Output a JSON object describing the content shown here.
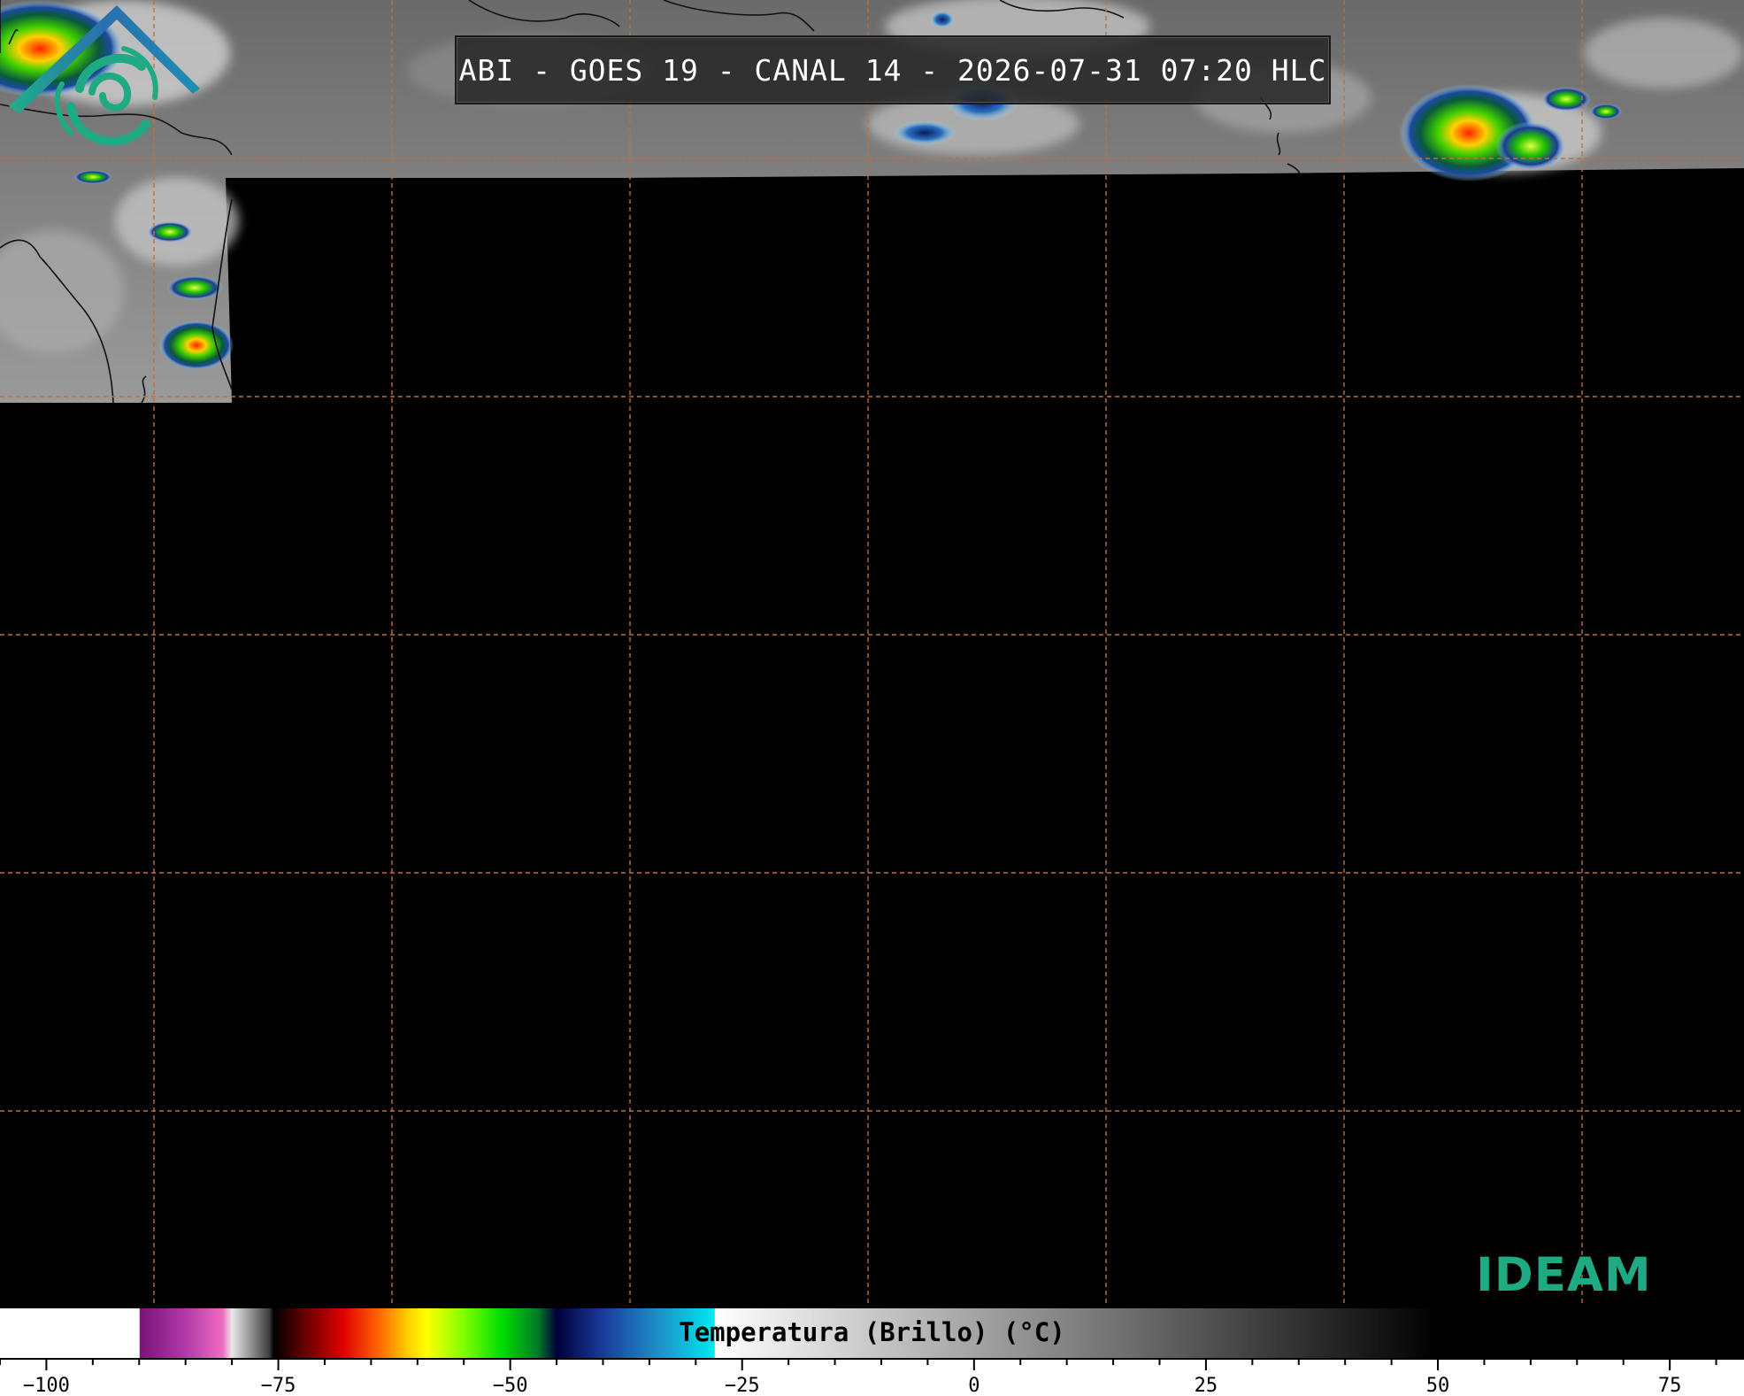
{
  "title": {
    "text": "ABI - GOES 19 - CANAL 14 - 2026-07-31 07:20 HLC"
  },
  "colorbar": {
    "label": "Temperatura (Brillo) (°C)",
    "min": -105,
    "max": 83,
    "ticks": [
      -100,
      -75,
      -50,
      -25,
      0,
      25,
      50,
      75
    ],
    "tick_labels": [
      "−100",
      "−75",
      "−50",
      "−25",
      "0",
      "25",
      "50",
      "75"
    ],
    "minor_step": 5,
    "color_stops": [
      {
        "value": -105,
        "color": "#ffffff"
      },
      {
        "value": -90,
        "color": "#ffffff"
      },
      {
        "value": -89.9,
        "color": "#7a1478"
      },
      {
        "value": -85,
        "color": "#b03aa8"
      },
      {
        "value": -81,
        "color": "#f06ac0"
      },
      {
        "value": -80,
        "color": "#e8e8e8"
      },
      {
        "value": -76,
        "color": "#404040"
      },
      {
        "value": -75.5,
        "color": "#000000"
      },
      {
        "value": -72,
        "color": "#6a0000"
      },
      {
        "value": -68,
        "color": "#e00000"
      },
      {
        "value": -64,
        "color": "#ff6a00"
      },
      {
        "value": -61,
        "color": "#ffd000"
      },
      {
        "value": -59,
        "color": "#ffff00"
      },
      {
        "value": -55,
        "color": "#80ff00"
      },
      {
        "value": -51,
        "color": "#00e000"
      },
      {
        "value": -47,
        "color": "#007a28"
      },
      {
        "value": -45,
        "color": "#00003a"
      },
      {
        "value": -40,
        "color": "#1a3a9a"
      },
      {
        "value": -34,
        "color": "#1e90c8"
      },
      {
        "value": -28,
        "color": "#00e8f0"
      },
      {
        "value": -27.9,
        "color": "#ffffff"
      },
      {
        "value": 50,
        "color": "#000000"
      },
      {
        "value": 83,
        "color": "#000000"
      }
    ]
  },
  "logo": {
    "text": "IDEAM",
    "color": "#1faa84",
    "accent": "#2a6fb0"
  },
  "map": {
    "background": "#000000",
    "grid_color": "#c0703a",
    "grid_style": "dashed",
    "cloud_colorscale": "brightness temperature"
  }
}
